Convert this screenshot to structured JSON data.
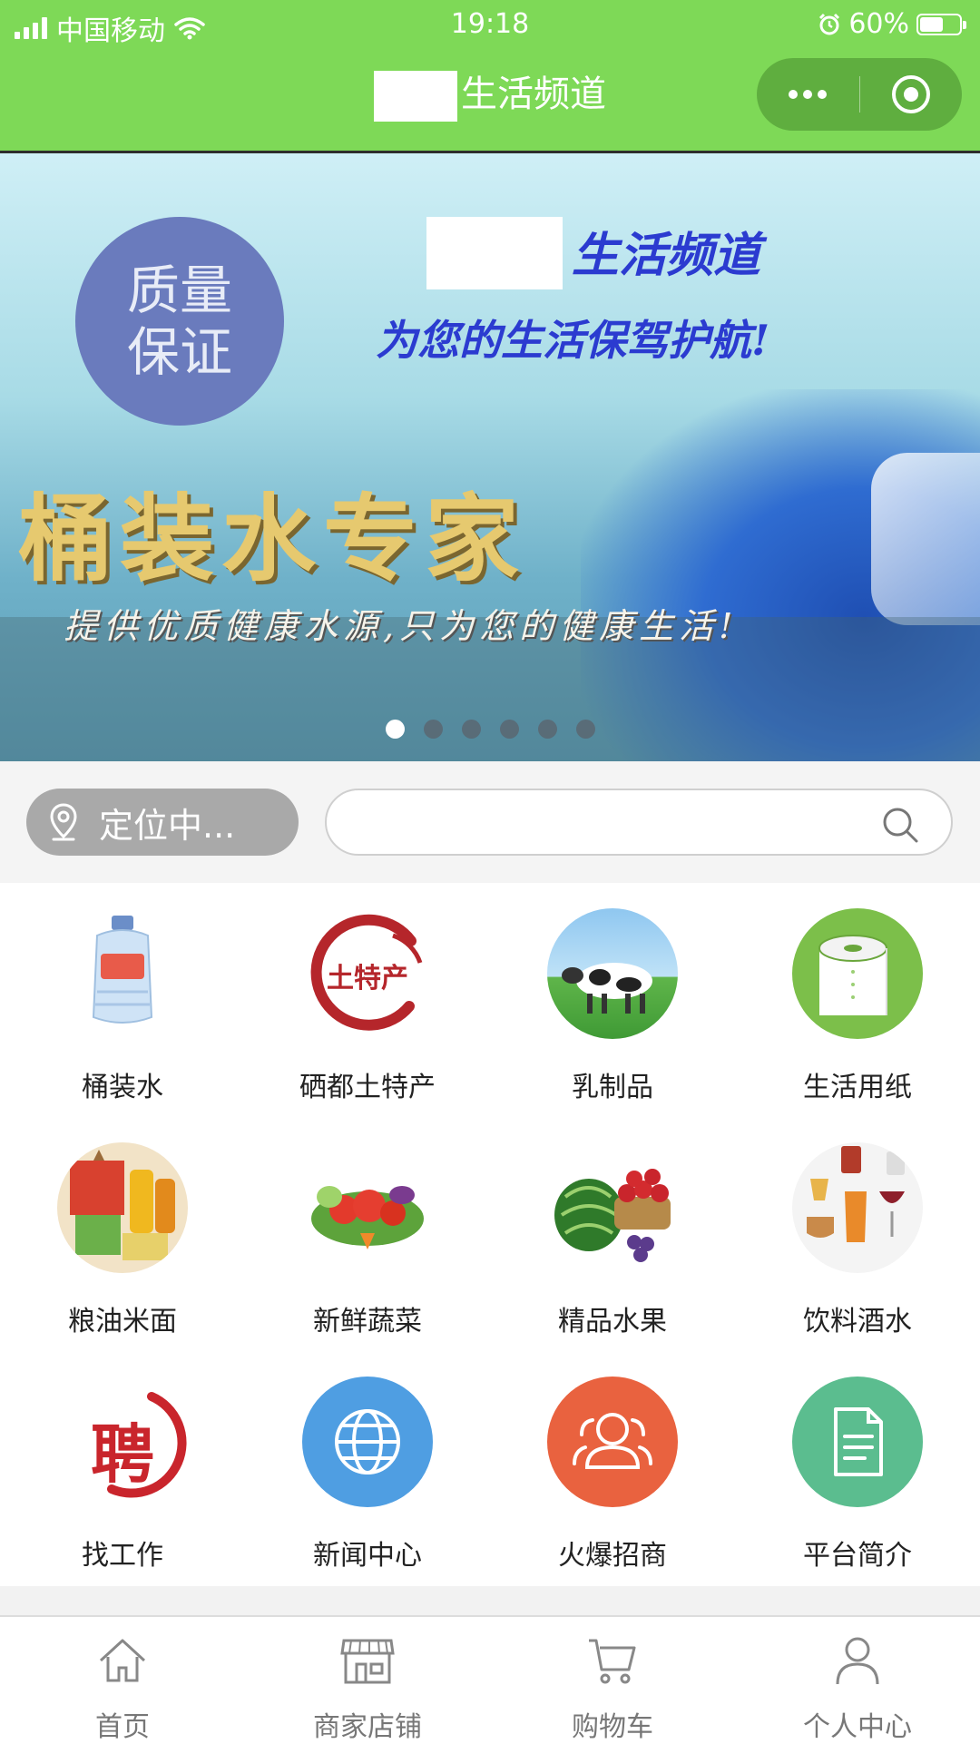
{
  "status_bar": {
    "carrier": "中国移动",
    "time": "19:18",
    "battery_percent": "60%",
    "battery_level": 0.6
  },
  "nav": {
    "title": "生活频道"
  },
  "banner": {
    "badge_line1": "质量",
    "badge_line2": "保证",
    "brand": "生活频道",
    "slogan": "为您的生活保驾护航!",
    "headline": "桶装水专家",
    "subline": "提供优质健康水源,只为您的健康生活!",
    "slides_total": 6,
    "active_slide": 1
  },
  "location": {
    "label": "定位中..."
  },
  "search": {
    "placeholder": "",
    "value": ""
  },
  "categories": [
    {
      "label": "桶装水",
      "icon": "water-bottle-icon"
    },
    {
      "label": "硒都土特产",
      "icon": "local-specialty-icon",
      "badge_text": "土特产"
    },
    {
      "label": "乳制品",
      "icon": "cow-icon"
    },
    {
      "label": "生活用纸",
      "icon": "tissue-roll-icon"
    },
    {
      "label": "粮油米面",
      "icon": "grain-oil-icon"
    },
    {
      "label": "新鲜蔬菜",
      "icon": "vegetables-icon"
    },
    {
      "label": "精品水果",
      "icon": "fruits-icon"
    },
    {
      "label": "饮料酒水",
      "icon": "drinks-icon"
    },
    {
      "label": "找工作",
      "icon": "job-hiring-icon",
      "badge_text": "聘"
    },
    {
      "label": "新闻中心",
      "icon": "globe-icon"
    },
    {
      "label": "火爆招商",
      "icon": "users-icon"
    },
    {
      "label": "平台简介",
      "icon": "document-icon"
    }
  ],
  "tabbar": [
    {
      "label": "首页",
      "icon": "home-icon"
    },
    {
      "label": "商家店铺",
      "icon": "store-icon"
    },
    {
      "label": "购物车",
      "icon": "cart-icon"
    },
    {
      "label": "个人中心",
      "icon": "user-icon"
    }
  ],
  "colors": {
    "header_green": "#7ed957",
    "capsule_green": "#5fae3f",
    "news_blue": "#4f9ee2",
    "merchant_orange": "#e9623f",
    "intro_green": "#5bbd8f",
    "tissue_green": "#7cbf4a"
  }
}
